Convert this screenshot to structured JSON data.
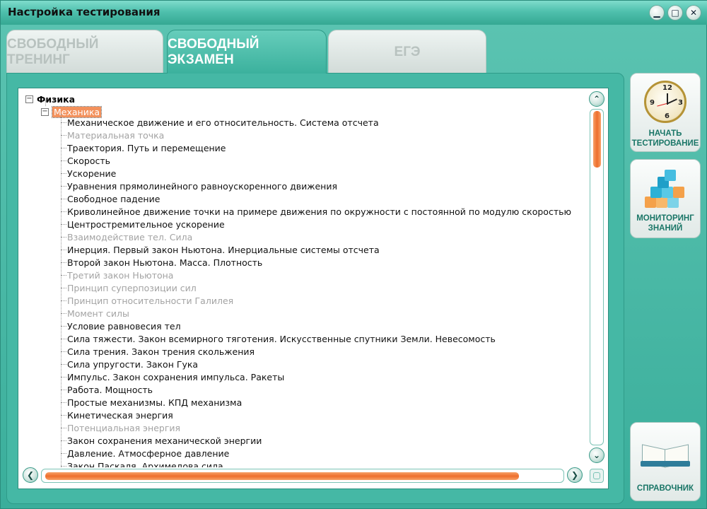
{
  "window": {
    "title": "Настройка тестирования"
  },
  "window_controls": {
    "minimize": "▁",
    "maximize": "□",
    "close": "✕"
  },
  "tabs": [
    {
      "label": "СВОБОДНЫЙ ТРЕНИНГ",
      "active": false
    },
    {
      "label": "СВОБОДНЫЙ ЭКЗАМЕН",
      "active": true
    },
    {
      "label": "ЕГЭ",
      "active": false
    }
  ],
  "tree": {
    "root_expander": "−",
    "root": "Физика",
    "branch_expander": "−",
    "branch": "Механика",
    "items": [
      {
        "label": "Механическое движение и его относительность. Система отсчета",
        "enabled": true
      },
      {
        "label": "Материальная точка",
        "enabled": false
      },
      {
        "label": "Траектория. Путь и перемещение",
        "enabled": true
      },
      {
        "label": "Скорость",
        "enabled": true
      },
      {
        "label": "Ускорение",
        "enabled": true
      },
      {
        "label": "Уравнения прямолинейного равноускоренного движения",
        "enabled": true
      },
      {
        "label": "Свободное падение",
        "enabled": true
      },
      {
        "label": "Криволинейное движение точки на примере движения по окружности с постоянной по модулю скоростью",
        "enabled": true
      },
      {
        "label": "Центростремительное ускорение",
        "enabled": true
      },
      {
        "label": "Взаимодействие тел. Сила",
        "enabled": false
      },
      {
        "label": "Инерция. Первый закон Ньютона. Инерциальные системы отсчета",
        "enabled": true
      },
      {
        "label": "Второй закон Ньютона. Масса. Плотность",
        "enabled": true
      },
      {
        "label": "Третий закон Ньютона",
        "enabled": false
      },
      {
        "label": "Принцип суперпозиции сил",
        "enabled": false
      },
      {
        "label": "Принцип относительности Галилея",
        "enabled": false
      },
      {
        "label": "Момент силы",
        "enabled": false
      },
      {
        "label": "Условие равновесия тел",
        "enabled": true
      },
      {
        "label": "Сила тяжести. Закон всемирного тяготения. Искусственные спутники Земли. Невесомость",
        "enabled": true
      },
      {
        "label": "Сила трения. Закон трения скольжения",
        "enabled": true
      },
      {
        "label": "Сила упругости. Закон Гука",
        "enabled": true
      },
      {
        "label": "Импульс. Закон сохранения импульса. Ракеты",
        "enabled": true
      },
      {
        "label": "Работа. Мощность",
        "enabled": true
      },
      {
        "label": "Простые механизмы. КПД механизма",
        "enabled": true
      },
      {
        "label": "Кинетическая энергия",
        "enabled": true
      },
      {
        "label": "Потенциальная энергия",
        "enabled": false
      },
      {
        "label": "Закон сохранения механической энергии",
        "enabled": true
      },
      {
        "label": "Давление. Атмосферное давление",
        "enabled": true
      },
      {
        "label": "Закон Паскаля. Архимедова сила",
        "enabled": true
      }
    ]
  },
  "scrollbars": {
    "vertical": {
      "up": "⌃",
      "down": "⌄",
      "position": 0.0,
      "visible_fraction": 0.17
    },
    "horizontal": {
      "left": "❮",
      "right": "❯",
      "position": 0.0,
      "visible_fraction": 0.92
    }
  },
  "sidebar": {
    "start_test": "НАЧАТЬ\nТЕСТИРОВАНИЕ",
    "monitoring": "МОНИТОРИНГ\nЗНАНИЙ",
    "reference": "СПРАВОЧНИК"
  },
  "clock_numbers": [
    "12",
    "3",
    "6",
    "9"
  ],
  "colors": {
    "accent": "#3fb3a0",
    "selection": "#f3915c",
    "scroll_thumb": "#ee6f2d"
  }
}
